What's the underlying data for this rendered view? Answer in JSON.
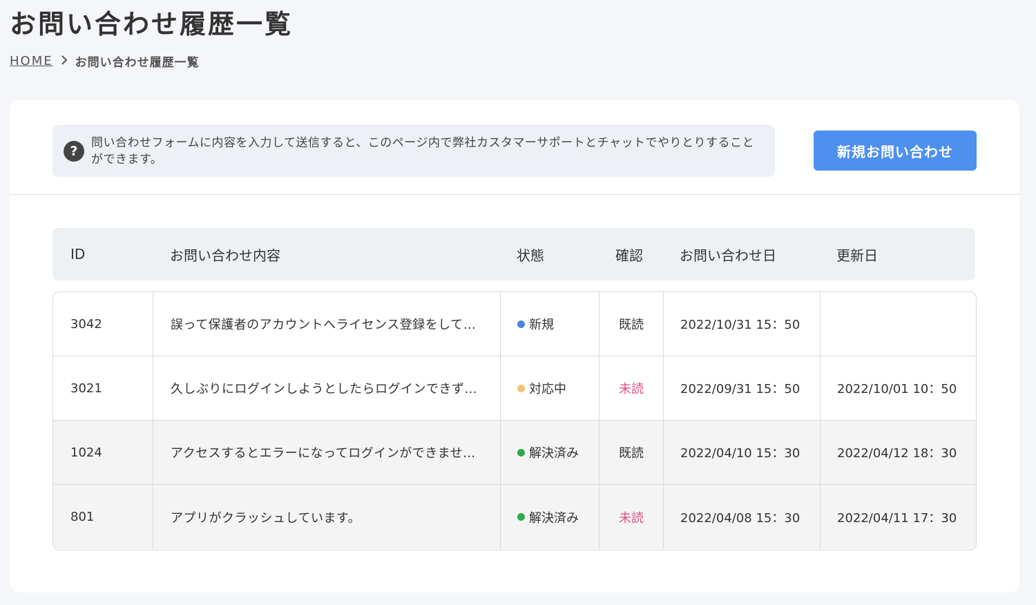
{
  "page": {
    "title": "お問い合わせ履歴一覧"
  },
  "breadcrumb": {
    "home": "HOME",
    "current": "お問い合わせ履歴一覧"
  },
  "notice": {
    "icon": "question-circle-icon",
    "text": "問い合わせフォームに内容を入力して送信すると、このページ内で弊社カスタマーサポートとチャットでやりとりすることができます。"
  },
  "actions": {
    "new_inquiry": "新規お問い合わせ"
  },
  "table": {
    "headers": {
      "id": "ID",
      "content": "お問い合わせ内容",
      "status": "状態",
      "confirm": "確認",
      "created": "お問い合わせ日",
      "updated": "更新日"
    },
    "rows": [
      {
        "id": "3042",
        "content": "誤って保護者のアカウントへライセンス登録をして…",
        "status": "新規",
        "status_color": "#4a86e8",
        "confirm": "既読",
        "confirm_unread": false,
        "created": "2022/10/31 15：50",
        "updated": ""
      },
      {
        "id": "3021",
        "content": "久しぶりにログインしようとしたらログインできず…",
        "status": "対応中",
        "status_color": "#f5c27a",
        "confirm": "未読",
        "confirm_unread": true,
        "created": "2022/09/31 15：50",
        "updated": "2022/10/01 10：50"
      },
      {
        "id": "1024",
        "content": "アクセスするとエラーになってログインができませ…",
        "status": "解決済み",
        "status_color": "#2eaa4a",
        "confirm": "既読",
        "confirm_unread": false,
        "created": "2022/04/10 15：30",
        "updated": "2022/04/12 18：30"
      },
      {
        "id": "801",
        "content": "アプリがクラッシュしています。",
        "status": "解決済み",
        "status_color": "#2eaa4a",
        "confirm": "未読",
        "confirm_unread": true,
        "created": "2022/04/08 15：30",
        "updated": "2022/04/11 17：30"
      }
    ]
  },
  "colors": {
    "accent": "#4d90f0",
    "unread": "#e0508a"
  }
}
